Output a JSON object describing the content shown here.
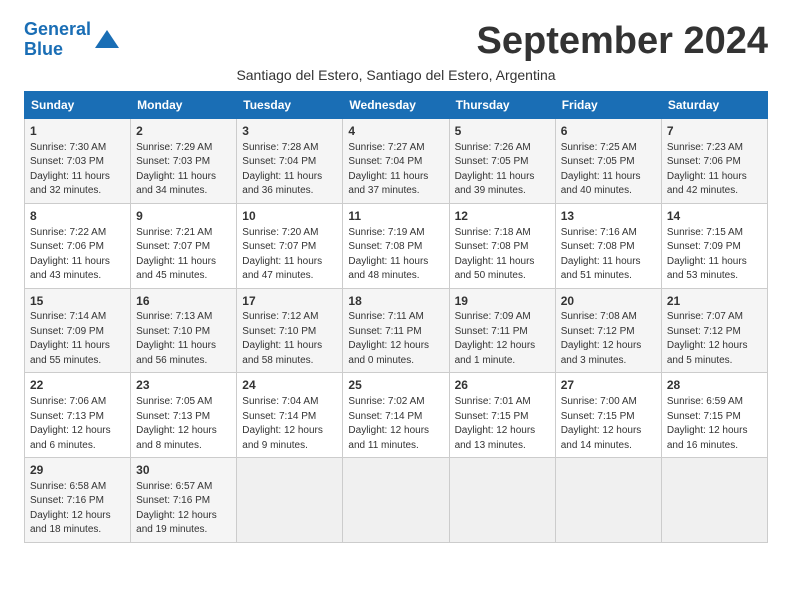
{
  "header": {
    "logo_line1": "General",
    "logo_line2": "Blue",
    "month": "September 2024",
    "location": "Santiago del Estero, Santiago del Estero, Argentina"
  },
  "weekdays": [
    "Sunday",
    "Monday",
    "Tuesday",
    "Wednesday",
    "Thursday",
    "Friday",
    "Saturday"
  ],
  "weeks": [
    [
      {
        "day": "1",
        "info": "Sunrise: 7:30 AM\nSunset: 7:03 PM\nDaylight: 11 hours\nand 32 minutes."
      },
      {
        "day": "2",
        "info": "Sunrise: 7:29 AM\nSunset: 7:03 PM\nDaylight: 11 hours\nand 34 minutes."
      },
      {
        "day": "3",
        "info": "Sunrise: 7:28 AM\nSunset: 7:04 PM\nDaylight: 11 hours\nand 36 minutes."
      },
      {
        "day": "4",
        "info": "Sunrise: 7:27 AM\nSunset: 7:04 PM\nDaylight: 11 hours\nand 37 minutes."
      },
      {
        "day": "5",
        "info": "Sunrise: 7:26 AM\nSunset: 7:05 PM\nDaylight: 11 hours\nand 39 minutes."
      },
      {
        "day": "6",
        "info": "Sunrise: 7:25 AM\nSunset: 7:05 PM\nDaylight: 11 hours\nand 40 minutes."
      },
      {
        "day": "7",
        "info": "Sunrise: 7:23 AM\nSunset: 7:06 PM\nDaylight: 11 hours\nand 42 minutes."
      }
    ],
    [
      {
        "day": "8",
        "info": "Sunrise: 7:22 AM\nSunset: 7:06 PM\nDaylight: 11 hours\nand 43 minutes."
      },
      {
        "day": "9",
        "info": "Sunrise: 7:21 AM\nSunset: 7:07 PM\nDaylight: 11 hours\nand 45 minutes."
      },
      {
        "day": "10",
        "info": "Sunrise: 7:20 AM\nSunset: 7:07 PM\nDaylight: 11 hours\nand 47 minutes."
      },
      {
        "day": "11",
        "info": "Sunrise: 7:19 AM\nSunset: 7:08 PM\nDaylight: 11 hours\nand 48 minutes."
      },
      {
        "day": "12",
        "info": "Sunrise: 7:18 AM\nSunset: 7:08 PM\nDaylight: 11 hours\nand 50 minutes."
      },
      {
        "day": "13",
        "info": "Sunrise: 7:16 AM\nSunset: 7:08 PM\nDaylight: 11 hours\nand 51 minutes."
      },
      {
        "day": "14",
        "info": "Sunrise: 7:15 AM\nSunset: 7:09 PM\nDaylight: 11 hours\nand 53 minutes."
      }
    ],
    [
      {
        "day": "15",
        "info": "Sunrise: 7:14 AM\nSunset: 7:09 PM\nDaylight: 11 hours\nand 55 minutes."
      },
      {
        "day": "16",
        "info": "Sunrise: 7:13 AM\nSunset: 7:10 PM\nDaylight: 11 hours\nand 56 minutes."
      },
      {
        "day": "17",
        "info": "Sunrise: 7:12 AM\nSunset: 7:10 PM\nDaylight: 11 hours\nand 58 minutes."
      },
      {
        "day": "18",
        "info": "Sunrise: 7:11 AM\nSunset: 7:11 PM\nDaylight: 12 hours\nand 0 minutes."
      },
      {
        "day": "19",
        "info": "Sunrise: 7:09 AM\nSunset: 7:11 PM\nDaylight: 12 hours\nand 1 minute."
      },
      {
        "day": "20",
        "info": "Sunrise: 7:08 AM\nSunset: 7:12 PM\nDaylight: 12 hours\nand 3 minutes."
      },
      {
        "day": "21",
        "info": "Sunrise: 7:07 AM\nSunset: 7:12 PM\nDaylight: 12 hours\nand 5 minutes."
      }
    ],
    [
      {
        "day": "22",
        "info": "Sunrise: 7:06 AM\nSunset: 7:13 PM\nDaylight: 12 hours\nand 6 minutes."
      },
      {
        "day": "23",
        "info": "Sunrise: 7:05 AM\nSunset: 7:13 PM\nDaylight: 12 hours\nand 8 minutes."
      },
      {
        "day": "24",
        "info": "Sunrise: 7:04 AM\nSunset: 7:14 PM\nDaylight: 12 hours\nand 9 minutes."
      },
      {
        "day": "25",
        "info": "Sunrise: 7:02 AM\nSunset: 7:14 PM\nDaylight: 12 hours\nand 11 minutes."
      },
      {
        "day": "26",
        "info": "Sunrise: 7:01 AM\nSunset: 7:15 PM\nDaylight: 12 hours\nand 13 minutes."
      },
      {
        "day": "27",
        "info": "Sunrise: 7:00 AM\nSunset: 7:15 PM\nDaylight: 12 hours\nand 14 minutes."
      },
      {
        "day": "28",
        "info": "Sunrise: 6:59 AM\nSunset: 7:15 PM\nDaylight: 12 hours\nand 16 minutes."
      }
    ],
    [
      {
        "day": "29",
        "info": "Sunrise: 6:58 AM\nSunset: 7:16 PM\nDaylight: 12 hours\nand 18 minutes."
      },
      {
        "day": "30",
        "info": "Sunrise: 6:57 AM\nSunset: 7:16 PM\nDaylight: 12 hours\nand 19 minutes."
      },
      {
        "day": "",
        "info": ""
      },
      {
        "day": "",
        "info": ""
      },
      {
        "day": "",
        "info": ""
      },
      {
        "day": "",
        "info": ""
      },
      {
        "day": "",
        "info": ""
      }
    ]
  ]
}
